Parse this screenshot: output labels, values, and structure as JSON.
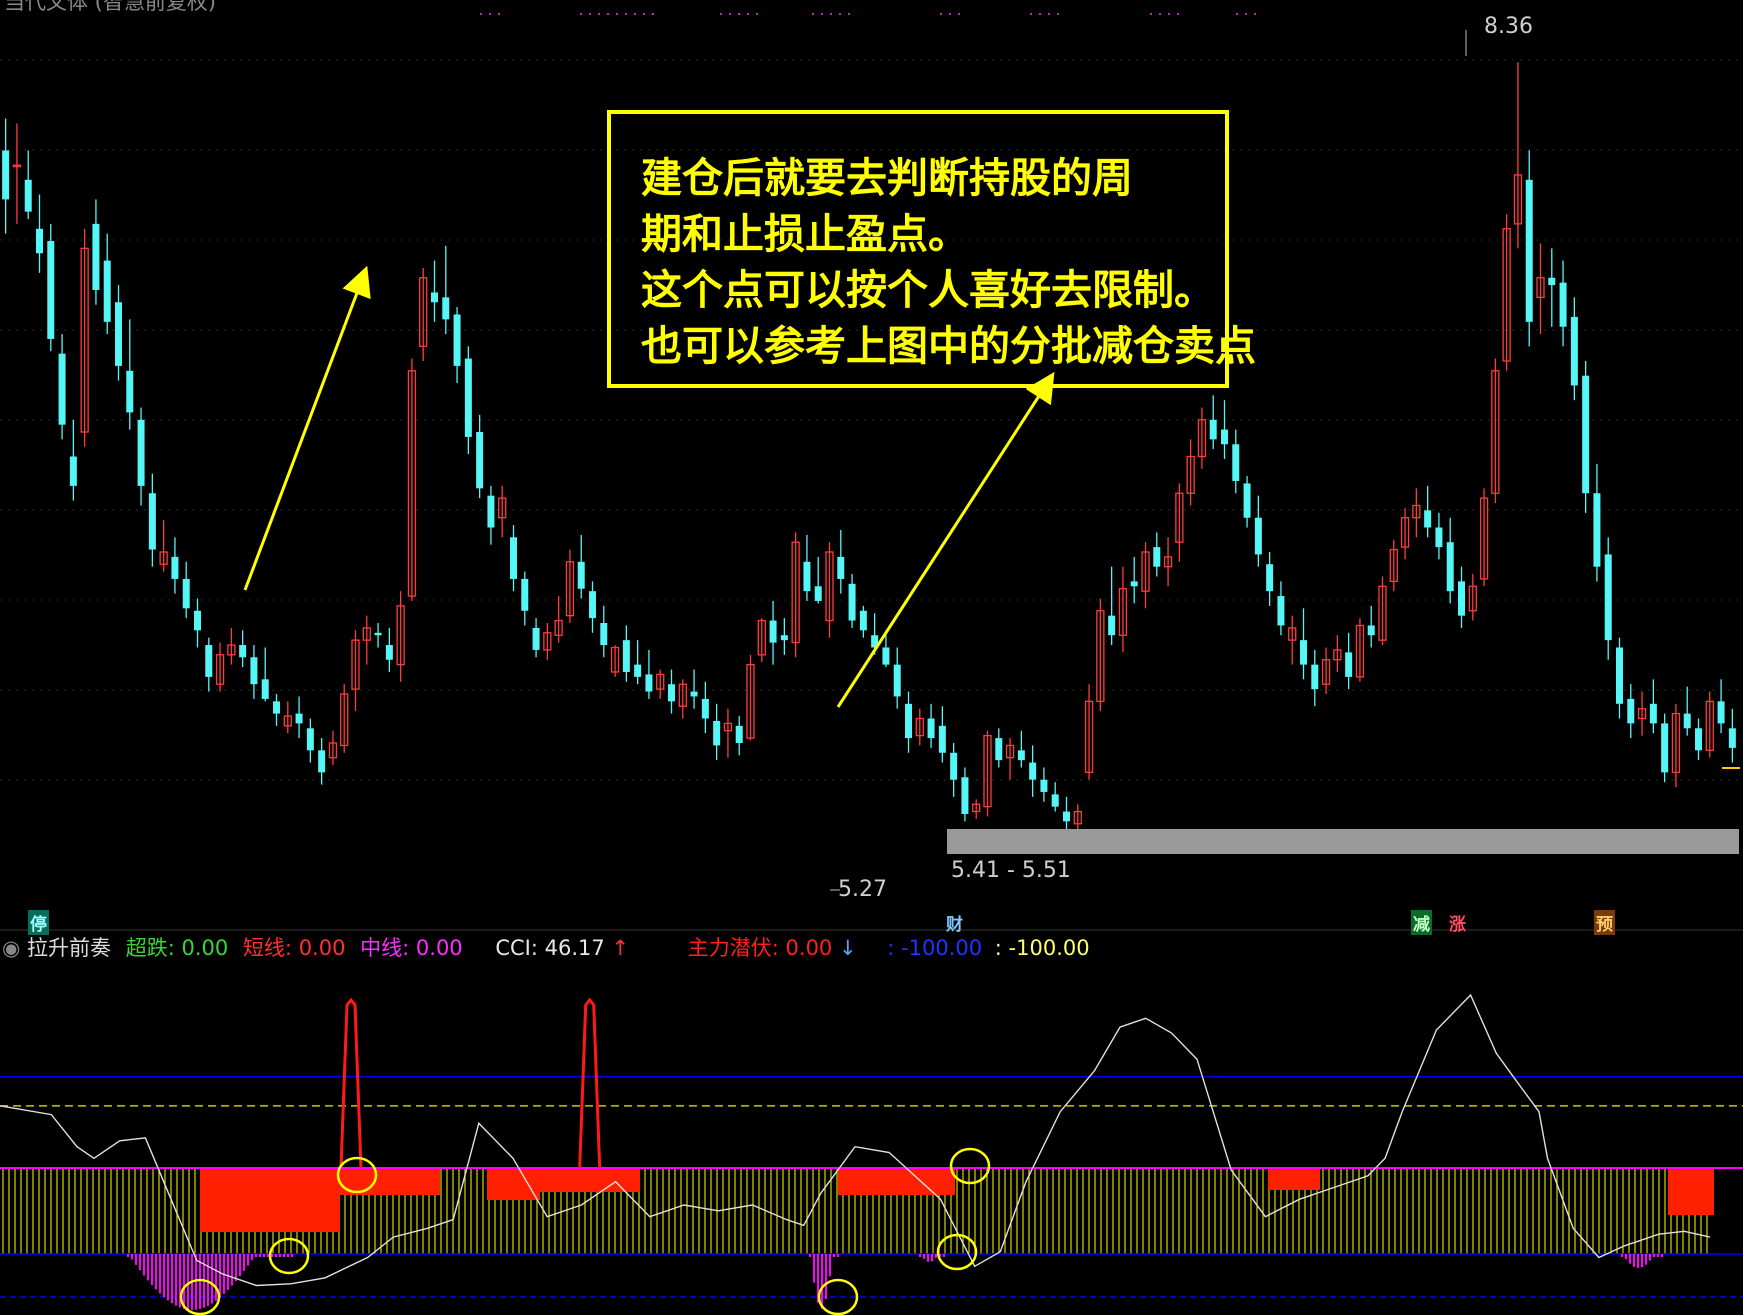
{
  "window": {
    "title_fragment": "当代文体 (智慧前复权)"
  },
  "note": {
    "lines": [
      "建仓后就要去判断持股的周",
      "期和止损止盈点。",
      "这个点可以按个人喜好去限制。",
      "也可以参考上图中的分批减仓卖点"
    ],
    "color": "#ffff00"
  },
  "colors": {
    "up": "#ff3c3c",
    "down": "#54f6f6",
    "annotation": "#ffff00",
    "indicator_up": "#ff2000",
    "indicator_magenta": "#ff00ff",
    "band": "#0000ff"
  },
  "price_labels": {
    "high": "8.36",
    "low": "5.27",
    "range": "5.41 - 5.51"
  },
  "event_tags": {
    "stop": "停",
    "finance": "财",
    "reduce": "减",
    "rise": "涨",
    "forecast": "预"
  },
  "indicator": {
    "name": "拉升前奏",
    "chaodie_label": "超跌:",
    "chaodie_value": "0.00",
    "duanxian_label": "短线:",
    "duanxian_value": "0.00",
    "zhongxian_label": "中线:",
    "zhongxian_value": "0.00",
    "cci_label": "CCI:",
    "cci_value": "46.17",
    "cci_arrow": "↑",
    "zhuli_label": "主力潜伏:",
    "zhuli_value": "0.00",
    "zhuli_arrow": "↓",
    "band_low_label": ": -100.00",
    "band_low2_label": ": -100.00"
  },
  "chart_data": {
    "type": "candlestick",
    "title": "",
    "ylim": [
      5.0,
      8.5
    ],
    "candles_ohlc": [
      [
        8.0,
        8.13,
        7.66,
        7.8
      ],
      [
        7.94,
        8.11,
        7.7,
        7.94
      ],
      [
        7.88,
        8.0,
        7.72,
        7.75
      ],
      [
        7.68,
        7.82,
        7.5,
        7.58
      ],
      [
        7.63,
        7.7,
        7.18,
        7.23
      ],
      [
        7.17,
        7.25,
        6.82,
        6.88
      ],
      [
        6.75,
        6.9,
        6.57,
        6.63
      ],
      [
        6.85,
        7.68,
        6.79,
        7.6
      ],
      [
        7.7,
        7.8,
        7.37,
        7.43
      ],
      [
        7.55,
        7.66,
        7.25,
        7.3
      ],
      [
        7.38,
        7.45,
        7.06,
        7.12
      ],
      [
        7.1,
        7.31,
        6.86,
        6.93
      ],
      [
        6.9,
        6.95,
        6.55,
        6.63
      ],
      [
        6.6,
        6.68,
        6.3,
        6.37
      ],
      [
        6.31,
        6.49,
        6.28,
        6.36
      ],
      [
        6.34,
        6.42,
        6.19,
        6.25
      ],
      [
        6.25,
        6.32,
        6.09,
        6.13
      ],
      [
        6.12,
        6.17,
        5.97,
        6.04
      ],
      [
        5.98,
        6.01,
        5.79,
        5.85
      ],
      [
        5.82,
        5.99,
        5.79,
        5.94
      ],
      [
        5.94,
        6.05,
        5.9,
        5.98
      ],
      [
        5.98,
        6.04,
        5.89,
        5.93
      ],
      [
        5.93,
        5.98,
        5.76,
        5.82
      ],
      [
        5.84,
        5.97,
        5.75,
        5.76
      ],
      [
        5.75,
        5.78,
        5.65,
        5.7
      ],
      [
        5.65,
        5.75,
        5.62,
        5.69
      ],
      [
        5.7,
        5.77,
        5.6,
        5.66
      ],
      [
        5.64,
        5.68,
        5.5,
        5.55
      ],
      [
        5.55,
        5.6,
        5.41,
        5.46
      ],
      [
        5.52,
        5.63,
        5.49,
        5.58
      ],
      [
        5.57,
        5.82,
        5.54,
        5.78
      ],
      [
        5.8,
        6.04,
        5.71,
        6.0
      ],
      [
        6.0,
        6.1,
        5.9,
        6.05
      ],
      [
        6.03,
        6.07,
        5.97,
        6.02
      ],
      [
        5.98,
        6.05,
        5.87,
        5.92
      ],
      [
        5.9,
        6.2,
        5.83,
        6.14
      ],
      [
        6.18,
        7.15,
        6.16,
        7.1
      ],
      [
        7.2,
        7.52,
        7.14,
        7.48
      ],
      [
        7.42,
        7.55,
        7.3,
        7.38
      ],
      [
        7.4,
        7.61,
        7.25,
        7.31
      ],
      [
        7.33,
        7.36,
        7.05,
        7.12
      ],
      [
        7.15,
        7.2,
        6.76,
        6.83
      ],
      [
        6.85,
        6.92,
        6.58,
        6.62
      ],
      [
        6.59,
        6.63,
        6.39,
        6.46
      ],
      [
        6.5,
        6.63,
        6.42,
        6.58
      ],
      [
        6.42,
        6.47,
        6.2,
        6.25
      ],
      [
        6.25,
        6.28,
        6.06,
        6.12
      ],
      [
        6.05,
        6.09,
        5.93,
        5.96
      ],
      [
        5.96,
        6.07,
        5.92,
        6.03
      ],
      [
        6.02,
        6.18,
        5.99,
        6.08
      ],
      [
        6.1,
        6.37,
        6.07,
        6.32
      ],
      [
        6.32,
        6.43,
        6.17,
        6.21
      ],
      [
        6.2,
        6.24,
        6.03,
        6.09
      ],
      [
        6.07,
        6.14,
        5.93,
        5.98
      ],
      [
        5.87,
        5.98,
        5.85,
        5.97
      ],
      [
        6.0,
        6.06,
        5.83,
        5.87
      ],
      [
        5.9,
        6.0,
        5.82,
        5.85
      ],
      [
        5.86,
        5.96,
        5.76,
        5.79
      ],
      [
        5.8,
        5.88,
        5.76,
        5.86
      ],
      [
        5.82,
        5.88,
        5.7,
        5.75
      ],
      [
        5.73,
        5.84,
        5.68,
        5.82
      ],
      [
        5.79,
        5.88,
        5.72,
        5.77
      ],
      [
        5.76,
        5.83,
        5.62,
        5.68
      ],
      [
        5.67,
        5.74,
        5.51,
        5.57
      ],
      [
        5.63,
        5.72,
        5.52,
        5.66
      ],
      [
        5.65,
        5.69,
        5.53,
        5.58
      ],
      [
        5.6,
        5.94,
        5.59,
        5.9
      ],
      [
        5.94,
        6.09,
        5.91,
        6.08
      ],
      [
        6.08,
        6.16,
        5.9,
        5.99
      ],
      [
        6.02,
        6.09,
        5.94,
        6.0
      ],
      [
        5.99,
        6.44,
        5.93,
        6.4
      ],
      [
        6.32,
        6.43,
        6.16,
        6.2
      ],
      [
        6.22,
        6.34,
        6.15,
        6.16
      ],
      [
        6.08,
        6.4,
        6.01,
        6.36
      ],
      [
        6.34,
        6.45,
        6.19,
        6.25
      ],
      [
        6.23,
        6.27,
        6.05,
        6.08
      ],
      [
        6.12,
        6.14,
        6.01,
        6.04
      ],
      [
        6.02,
        6.11,
        5.94,
        5.97
      ],
      [
        5.97,
        6.04,
        5.89,
        5.9
      ],
      [
        5.9,
        5.97,
        5.72,
        5.77
      ],
      [
        5.74,
        5.79,
        5.54,
        5.6
      ],
      [
        5.61,
        5.72,
        5.57,
        5.68
      ],
      [
        5.68,
        5.74,
        5.56,
        5.6
      ],
      [
        5.65,
        5.73,
        5.5,
        5.54
      ],
      [
        5.54,
        5.58,
        5.36,
        5.43
      ],
      [
        5.44,
        5.48,
        5.26,
        5.29
      ],
      [
        5.3,
        5.35,
        5.27,
        5.33
      ],
      [
        5.32,
        5.63,
        5.28,
        5.61
      ],
      [
        5.6,
        5.64,
        5.48,
        5.51
      ],
      [
        5.52,
        5.6,
        5.43,
        5.57
      ],
      [
        5.55,
        5.63,
        5.48,
        5.51
      ],
      [
        5.5,
        5.57,
        5.36,
        5.43
      ],
      [
        5.43,
        5.48,
        5.34,
        5.38
      ],
      [
        5.37,
        5.42,
        5.3,
        5.32
      ],
      [
        5.3,
        5.36,
        5.21,
        5.26
      ],
      [
        5.25,
        5.33,
        5.22,
        5.3
      ],
      [
        5.46,
        5.82,
        5.43,
        5.75
      ],
      [
        5.75,
        6.17,
        5.71,
        6.12
      ],
      [
        6.1,
        6.3,
        5.98,
        6.02
      ],
      [
        6.02,
        6.3,
        5.95,
        6.21
      ],
      [
        6.24,
        6.34,
        6.15,
        6.22
      ],
      [
        6.2,
        6.4,
        6.13,
        6.36
      ],
      [
        6.38,
        6.44,
        6.26,
        6.3
      ],
      [
        6.3,
        6.42,
        6.22,
        6.34
      ],
      [
        6.4,
        6.64,
        6.32,
        6.6
      ],
      [
        6.6,
        6.82,
        6.55,
        6.75
      ],
      [
        6.75,
        6.95,
        6.7,
        6.9
      ],
      [
        6.9,
        7.0,
        6.78,
        6.82
      ],
      [
        6.86,
        6.98,
        6.74,
        6.8
      ],
      [
        6.8,
        6.86,
        6.6,
        6.65
      ],
      [
        6.64,
        6.67,
        6.46,
        6.5
      ],
      [
        6.5,
        6.59,
        6.3,
        6.35
      ],
      [
        6.31,
        6.36,
        6.14,
        6.2
      ],
      [
        6.18,
        6.24,
        6.02,
        6.06
      ],
      [
        6.0,
        6.1,
        5.9,
        6.05
      ],
      [
        6.0,
        6.13,
        5.84,
        5.9
      ],
      [
        5.9,
        5.96,
        5.73,
        5.8
      ],
      [
        5.82,
        5.97,
        5.78,
        5.92
      ],
      [
        5.92,
        6.02,
        5.87,
        5.96
      ],
      [
        5.95,
        6.03,
        5.8,
        5.85
      ],
      [
        5.85,
        6.09,
        5.83,
        6.06
      ],
      [
        6.06,
        6.14,
        5.97,
        6.02
      ],
      [
        6.0,
        6.26,
        5.98,
        6.22
      ],
      [
        6.24,
        6.41,
        6.2,
        6.37
      ],
      [
        6.38,
        6.54,
        6.33,
        6.5
      ],
      [
        6.5,
        6.62,
        6.42,
        6.55
      ],
      [
        6.53,
        6.63,
        6.42,
        6.46
      ],
      [
        6.46,
        6.52,
        6.33,
        6.38
      ],
      [
        6.4,
        6.5,
        6.15,
        6.2
      ],
      [
        6.24,
        6.3,
        6.05,
        6.1
      ],
      [
        6.12,
        6.27,
        6.08,
        6.22
      ],
      [
        6.25,
        6.62,
        6.22,
        6.58
      ],
      [
        6.6,
        7.15,
        6.56,
        7.1
      ],
      [
        7.14,
        7.74,
        7.1,
        7.68
      ],
      [
        7.7,
        8.36,
        7.6,
        7.9
      ],
      [
        7.88,
        8.0,
        7.2,
        7.3
      ],
      [
        7.4,
        7.62,
        7.25,
        7.48
      ],
      [
        7.48,
        7.6,
        7.28,
        7.45
      ],
      [
        7.46,
        7.55,
        7.2,
        7.28
      ],
      [
        7.32,
        7.4,
        6.98,
        7.04
      ],
      [
        7.08,
        7.14,
        6.52,
        6.6
      ],
      [
        6.6,
        6.72,
        6.24,
        6.3
      ],
      [
        6.35,
        6.42,
        5.92,
        6.0
      ],
      [
        5.97,
        6.01,
        5.68,
        5.74
      ],
      [
        5.76,
        5.82,
        5.6,
        5.66
      ],
      [
        5.68,
        5.79,
        5.61,
        5.72
      ],
      [
        5.74,
        5.84,
        5.62,
        5.66
      ],
      [
        5.66,
        5.7,
        5.42,
        5.46
      ],
      [
        5.46,
        5.74,
        5.4,
        5.7
      ],
      [
        5.7,
        5.81,
        5.61,
        5.64
      ],
      [
        5.64,
        5.68,
        5.51,
        5.55
      ],
      [
        5.55,
        5.79,
        5.52,
        5.75
      ],
      [
        5.75,
        5.84,
        5.62,
        5.66
      ],
      [
        5.64,
        5.72,
        5.5,
        5.56
      ]
    ],
    "annotations": [
      "8.36",
      "5.27",
      "5.41 - 5.51"
    ],
    "indicator_series": {
      "cci_x_fraction": [
        0.0,
        0.03,
        0.045,
        0.055,
        0.07,
        0.085,
        0.1,
        0.115,
        0.13,
        0.15,
        0.17,
        0.19,
        0.215,
        0.23,
        0.25,
        0.265,
        0.28,
        0.3,
        0.32,
        0.34,
        0.36,
        0.37,
        0.38,
        0.4,
        0.42,
        0.44,
        0.46,
        0.47,
        0.48,
        0.5,
        0.52,
        0.55,
        0.57,
        0.585,
        0.6,
        0.62,
        0.64,
        0.655,
        0.67,
        0.685,
        0.7,
        0.72,
        0.74,
        0.76,
        0.78,
        0.8,
        0.81,
        0.82,
        0.84,
        0.86,
        0.875,
        0.885,
        0.9,
        0.905,
        0.92,
        0.935,
        0.95,
        0.97,
        0.985,
        1.0
      ],
      "cci_value": [
        50,
        35,
        -20,
        -40,
        -10,
        -5,
        -110,
        -215,
        -238,
        -258,
        -255,
        -245,
        -210,
        -175,
        -160,
        -145,
        20,
        -40,
        -140,
        -120,
        -80,
        -110,
        -140,
        -120,
        -130,
        -120,
        -145,
        -155,
        -100,
        -20,
        -30,
        -110,
        -225,
        -200,
        -80,
        40,
        110,
        185,
        200,
        175,
        130,
        -60,
        -140,
        -110,
        -90,
        -70,
        -40,
        40,
        180,
        240,
        140,
        100,
        40,
        -40,
        -160,
        -210,
        -190,
        -170,
        -165,
        -175
      ],
      "short_spikes_x_fraction": [
        0.2,
        0.34
      ],
      "band_levels": [
        100,
        50,
        -100,
        -150
      ]
    }
  }
}
